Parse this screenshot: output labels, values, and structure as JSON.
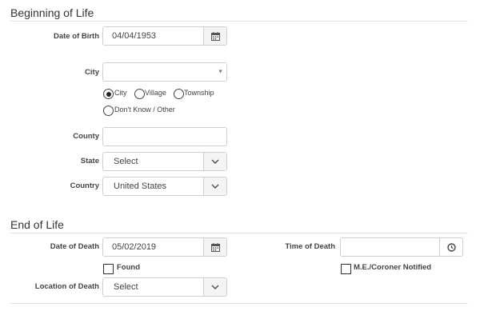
{
  "beginning": {
    "title": "Beginning of Life",
    "dob_label": "Date of Birth",
    "dob_value": "04/04/1953",
    "city_label": "City",
    "city_value": "",
    "radio_options": [
      "City",
      "Village",
      "Township",
      "Don't Know / Other"
    ],
    "radio_selected": "City",
    "county_label": "County",
    "county_value": "",
    "state_label": "State",
    "state_value": "Select",
    "country_label": "Country",
    "country_value": "United States"
  },
  "end": {
    "title": "End of Life",
    "dod_label": "Date of Death",
    "dod_value": "05/02/2019",
    "time_label": "Time of Death",
    "time_value": "",
    "found_label": "Found",
    "me_label": "M.E./Coroner Notified",
    "location_label": "Location of Death",
    "location_value": "Select"
  },
  "icons": {
    "calendar": "calendar-icon",
    "clock": "clock-icon",
    "chevron": "chevron-down-icon",
    "caret": "caret-down-icon"
  }
}
